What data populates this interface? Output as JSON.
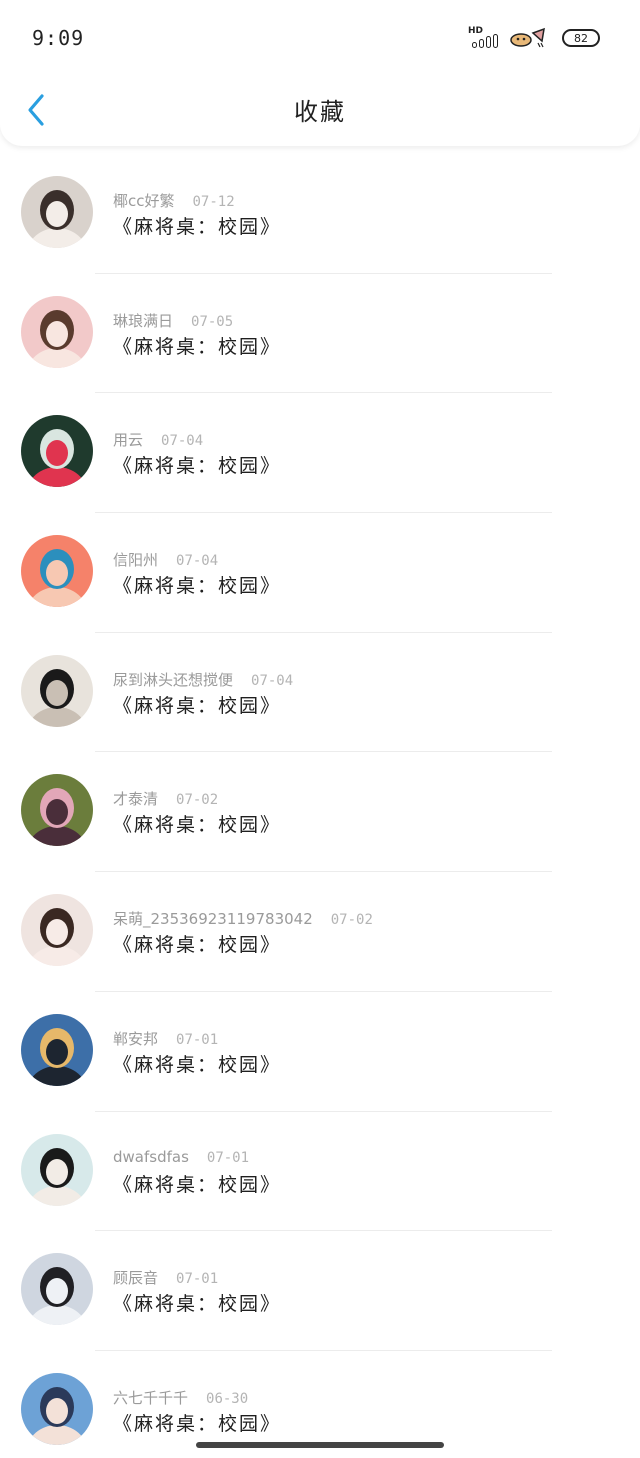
{
  "status_bar": {
    "time": "9:09",
    "network_label": "HD",
    "battery": "82"
  },
  "header": {
    "title": "收藏"
  },
  "favorites": [
    {
      "user": "椰cc好繁",
      "date": "07-12",
      "work": "《麻将桌：校园》",
      "avatar_colors": [
        "#d9d2cc",
        "#3a2f2b",
        "#f3ede8"
      ]
    },
    {
      "user": "琳琅满日",
      "date": "07-05",
      "work": "《麻将桌：校园》",
      "avatar_colors": [
        "#f2c9c9",
        "#5a3b2e",
        "#f8e6e0"
      ]
    },
    {
      "user": "用云",
      "date": "07-04",
      "work": "《麻将桌：校园》",
      "avatar_colors": [
        "#1f3a2d",
        "#d9e6e0",
        "#e0344f"
      ]
    },
    {
      "user": "信阳州",
      "date": "07-04",
      "work": "《麻将桌：校园》",
      "avatar_colors": [
        "#f5826a",
        "#2c8fbd",
        "#f7c8b2"
      ]
    },
    {
      "user": "尿到淋头还想搅便",
      "date": "07-04",
      "work": "《麻将桌：校园》",
      "avatar_colors": [
        "#e8e3dc",
        "#1a1a1a",
        "#c9bfb4"
      ]
    },
    {
      "user": "才泰清",
      "date": "07-02",
      "work": "《麻将桌：校园》",
      "avatar_colors": [
        "#6b7d3c",
        "#e2a7b8",
        "#4a2e3a"
      ]
    },
    {
      "user": "呆萌_23536923119783042",
      "date": "07-02",
      "work": "《麻将桌：校园》",
      "avatar_colors": [
        "#efe4e0",
        "#3a2822",
        "#f7ebe7"
      ]
    },
    {
      "user": "郸安邦",
      "date": "07-01",
      "work": "《麻将桌：校园》",
      "avatar_colors": [
        "#3d6fa8",
        "#e6b86a",
        "#1d2530"
      ]
    },
    {
      "user": "dwafsdfas",
      "date": "07-01",
      "work": "《麻将桌：校园》",
      "avatar_colors": [
        "#d7e9ea",
        "#1a1a1a",
        "#f2ece6"
      ]
    },
    {
      "user": "顾辰音",
      "date": "07-01",
      "work": "《麻将桌：校园》",
      "avatar_colors": [
        "#cfd6e0",
        "#202024",
        "#eef1f5"
      ]
    },
    {
      "user": "六七千千千",
      "date": "06-30",
      "work": "《麻将桌：校园》",
      "avatar_colors": [
        "#6da2d6",
        "#2b3a5a",
        "#f3e1d8"
      ]
    }
  ],
  "colors": {
    "accent": "#2a9fe0",
    "text_primary": "#1f1f1f",
    "text_secondary": "#9a9a9a"
  },
  "icons": {
    "back": "chevron-left-icon"
  }
}
